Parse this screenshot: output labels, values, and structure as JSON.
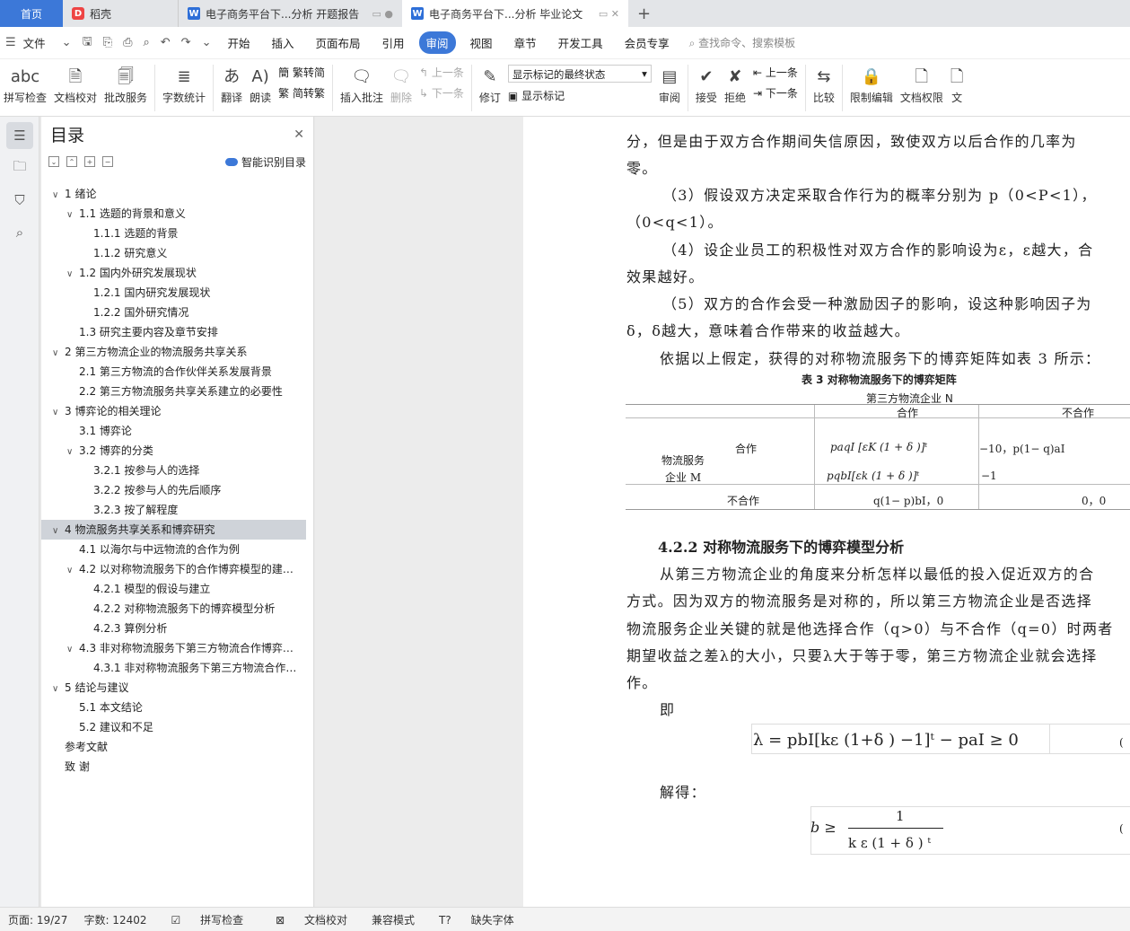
{
  "tabs": {
    "home": "首页",
    "t1": "稻壳",
    "t2": "电子商务平台下...分析 开题报告",
    "t3": "电子商务平台下...分析 毕业论文"
  },
  "menu": {
    "file": "文件",
    "items": [
      "开始",
      "插入",
      "页面布局",
      "引用",
      "审阅",
      "视图",
      "章节",
      "开发工具",
      "会员专享"
    ],
    "active": "审阅",
    "search": "查找命令、搜索模板"
  },
  "ribbon": {
    "spell": "拼写检查",
    "proof": "文档校对",
    "review_service": "批改服务",
    "wordcount": "字数统计",
    "translate": "翻译",
    "read": "朗读",
    "trad": "繁转简",
    "simp": "简转繁",
    "insert_comment": "插入批注",
    "delete": "删除",
    "prev": "上一条",
    "next": "下一条",
    "revise": "修订",
    "display_select": "显示标记的最终状态",
    "show_marks": "显示标记",
    "review": "审阅",
    "accept": "接受",
    "reject": "拒绝",
    "prev2": "上一条",
    "next2": "下一条",
    "compare": "比较",
    "restrict": "限制编辑",
    "doc_rights": "文档权限",
    "more": "文"
  },
  "toc": {
    "title": "目录",
    "smart": "智能识别目录",
    "items": [
      {
        "t": "1 绪论",
        "l": 1,
        "a": "v"
      },
      {
        "t": "1.1 选题的背景和意义",
        "l": 2,
        "a": "v"
      },
      {
        "t": "1.1.1 选题的背景",
        "l": 3,
        "a": ""
      },
      {
        "t": "1.1.2 研究意义",
        "l": 3,
        "a": ""
      },
      {
        "t": "1.2 国内外研究发展现状",
        "l": 2,
        "a": "v"
      },
      {
        "t": "1.2.1 国内研究发展现状",
        "l": 3,
        "a": ""
      },
      {
        "t": "1.2.2 国外研究情况",
        "l": 3,
        "a": ""
      },
      {
        "t": "1.3 研究主要内容及章节安排",
        "l": 2,
        "a": ""
      },
      {
        "t": "2 第三方物流企业的物流服务共享关系",
        "l": 1,
        "a": "v"
      },
      {
        "t": "2.1 第三方物流的合作伙伴关系发展背景",
        "l": 2,
        "a": ""
      },
      {
        "t": "2.2 第三方物流服务共享关系建立的必要性",
        "l": 2,
        "a": ""
      },
      {
        "t": "3 博弈论的相关理论",
        "l": 1,
        "a": "v"
      },
      {
        "t": "3.1 博弈论",
        "l": 2,
        "a": ""
      },
      {
        "t": "3.2 博弈的分类",
        "l": 2,
        "a": "v"
      },
      {
        "t": "3.2.1 按参与人的选择",
        "l": 3,
        "a": ""
      },
      {
        "t": "3.2.2 按参与人的先后顺序",
        "l": 3,
        "a": ""
      },
      {
        "t": "3.2.3 按了解程度",
        "l": 3,
        "a": ""
      },
      {
        "t": "4 物流服务共享关系和博弈研究",
        "l": 1,
        "a": "v",
        "sel": true
      },
      {
        "t": "4.1 以海尔与中远物流的合作为例",
        "l": 2,
        "a": ""
      },
      {
        "t": "4.2 以对称物流服务下的合作博弈模型的建…",
        "l": 2,
        "a": "v"
      },
      {
        "t": "4.2.1 模型的假设与建立",
        "l": 3,
        "a": ""
      },
      {
        "t": "4.2.2 对称物流服务下的博弈模型分析",
        "l": 3,
        "a": ""
      },
      {
        "t": "4.2.3 算例分析",
        "l": 3,
        "a": ""
      },
      {
        "t": "4.3 非对称物流服务下第三方物流合作博弈…",
        "l": 2,
        "a": "v"
      },
      {
        "t": "4.3.1 非对称物流服务下第三方物流合作…",
        "l": 3,
        "a": ""
      },
      {
        "t": "5 结论与建议",
        "l": 1,
        "a": "v"
      },
      {
        "t": "5.1 本文结论",
        "l": 2,
        "a": ""
      },
      {
        "t": "5.2 建议和不足",
        "l": 2,
        "a": ""
      },
      {
        "t": "参考文献",
        "l": 1,
        "a": ""
      },
      {
        "t": "致 谢",
        "l": 1,
        "a": ""
      }
    ]
  },
  "doc": {
    "lines": [
      "分，但是由于双方合作期间失信原因，致使双方以后合作的几率为",
      "零。",
      "（3）假设双方决定采取合作行为的概率分别为 p（0<P<1），",
      "（0<q<1）。",
      "（4）设企业员工的积极性对双方合作的影响设为ε，ε越大，合",
      "效果越好。",
      "（5）双方的合作会受一种激励因子的影响，设这种影响因子为",
      "δ，δ越大，意味着合作带来的收益越大。",
      "依据以上假定，获得的对称物流服务下的博弈矩阵如表 3 所示：",
      "从第三方物流企业的角度来分析怎样以最低的投入促近双方的合",
      "方式。因为双方的物流服务是对称的，所以第三方物流企业是否选择",
      "物流服务企业关键的就是他选择合作（q>0）与不合作（q=0）时两者",
      "期望收益之差λ的大小，只要λ大于等于零，第三方物流企业就会选择",
      "作。",
      "即",
      "解得："
    ],
    "table_caption": "表 3 对称物流服务下的博弈矩阵",
    "table": {
      "top": "第三方物流企业 N",
      "col1": "合作",
      "col2": "不合作",
      "row1": "合作",
      "rowlabel1": "物流服务",
      "rowlabel2": "企业 M",
      "row2": "不合作",
      "c11": "paqI [εK (1 + δ )]ᵗ",
      "c12": "−10，p(1− q)aI",
      "c21": "pqbI[εk (1 + δ )]ᵗ",
      "c22": "−1",
      "c31": "q(1− p)bI，0",
      "c32": "0，0"
    },
    "heading": "4.2.2 对称物流服务下的博弈模型分析",
    "formula1": "λ = pbI[kε (1+δ ) −1]ᵗ  − paI ≥ 0",
    "f2_lhs": "b ≥",
    "f2_num": "1",
    "f2_den": "k ε (1     + δ ) ᵗ",
    "f_no": "(",
    "f_no2": "("
  },
  "status": {
    "page": "页面: 19/27",
    "words": "字数: 12402",
    "spell": "拼写检查",
    "proof": "文档校对",
    "compat": "兼容模式",
    "font": "缺失字体"
  }
}
